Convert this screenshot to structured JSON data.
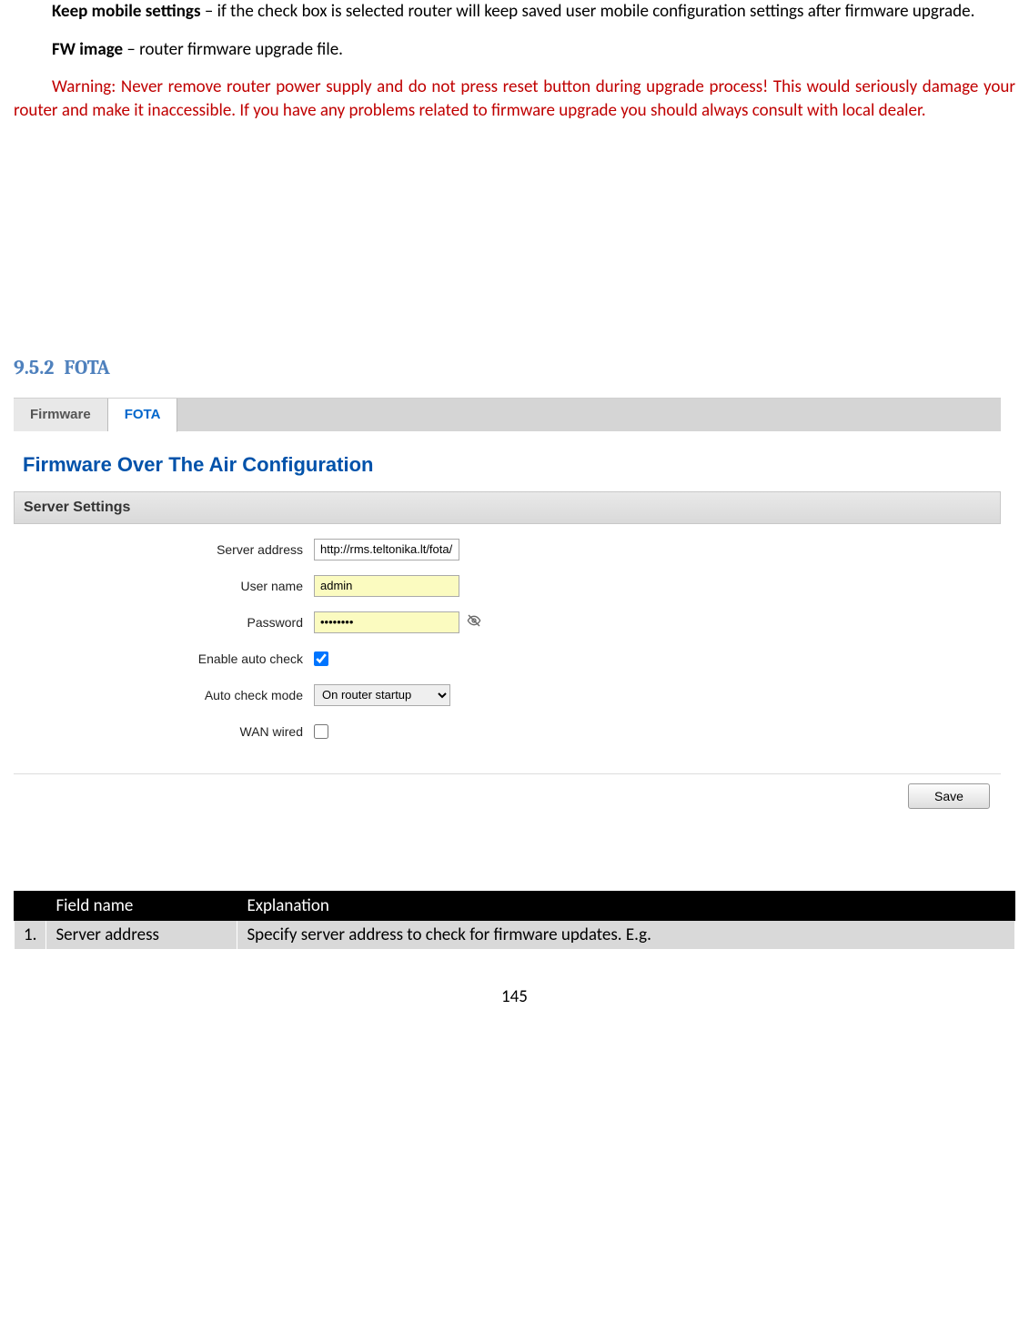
{
  "paragraphs": {
    "keep_mobile_label": "Keep mobile settings",
    "keep_mobile_text": " – if the check box is selected router will keep saved user mobile configuration settings after firmware upgrade.",
    "fw_image_label": "FW image",
    "fw_image_text": " – router firmware upgrade file.",
    "warning_text": "Warning: Never remove router power supply and do not press reset button during upgrade process! This would seriously damage your router and make it inaccessible. If you have any problems related to firmware upgrade you should always consult with local dealer."
  },
  "section": {
    "number": "9.5.2",
    "title": "FOTA"
  },
  "screenshot": {
    "tabs": {
      "firmware": "Firmware",
      "fota": "FOTA"
    },
    "config_title": "Firmware Over The Air Configuration",
    "section_header": "Server Settings",
    "labels": {
      "server_address": "Server address",
      "user_name": "User name",
      "password": "Password",
      "enable_auto_check": "Enable auto check",
      "auto_check_mode": "Auto check mode",
      "wan_wired": "WAN wired"
    },
    "values": {
      "server_address": "http://rms.teltonika.lt/fota/",
      "user_name": "admin",
      "password": "••••••••",
      "auto_check_mode": "On router startup"
    },
    "save_button": "Save"
  },
  "table": {
    "headers": {
      "num": "",
      "field": "Field name",
      "desc": "Explanation"
    },
    "row1": {
      "num": "1.",
      "field": "Server address",
      "desc": "Specify server address to check for firmware updates. E.g."
    }
  },
  "page_number": "145"
}
